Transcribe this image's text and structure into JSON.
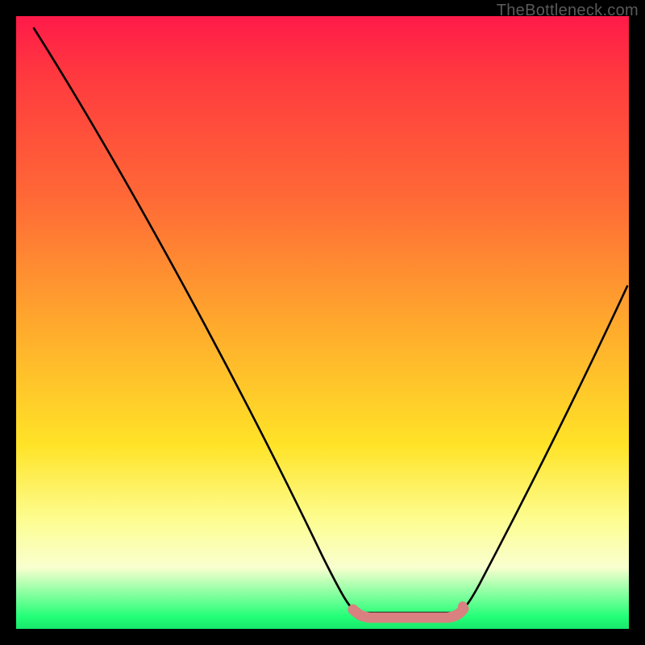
{
  "watermark": {
    "text": "TheBottleneck.com"
  },
  "chart_data": {
    "type": "line",
    "title": "",
    "xlabel": "",
    "ylabel": "",
    "xlim": [
      0,
      100
    ],
    "ylim": [
      0,
      100
    ],
    "grid": false,
    "legend": "none",
    "annotations": [],
    "series": [
      {
        "name": "curve-left",
        "x": [
          3,
          10,
          20,
          30,
          40,
          48,
          52,
          54,
          55.5
        ],
        "values": [
          98,
          88,
          73,
          57,
          40,
          23,
          12,
          6,
          3
        ]
      },
      {
        "name": "curve-right",
        "x": [
          72,
          74,
          77,
          82,
          88,
          94,
          100
        ],
        "values": [
          3,
          6,
          12,
          22,
          34,
          46,
          56
        ]
      },
      {
        "name": "flat-min-marker",
        "x": [
          55,
          57,
          59,
          61,
          63,
          65,
          67,
          69,
          70.5,
          72
        ],
        "values": [
          2.8,
          2.4,
          2.2,
          2.2,
          2.2,
          2.2,
          2.3,
          2.5,
          2.8,
          3.0
        ]
      }
    ],
    "background_gradient": {
      "stops": [
        {
          "pct": 0,
          "color": "#ff1a49"
        },
        {
          "pct": 10,
          "color": "#ff3a3f"
        },
        {
          "pct": 30,
          "color": "#ff6a36"
        },
        {
          "pct": 50,
          "color": "#ffa82d"
        },
        {
          "pct": 70,
          "color": "#ffe327"
        },
        {
          "pct": 82,
          "color": "#fdfd8f"
        },
        {
          "pct": 90,
          "color": "#f9ffcf"
        },
        {
          "pct": 98,
          "color": "#23ff77"
        },
        {
          "pct": 100,
          "color": "#19e86b"
        }
      ]
    },
    "curve_color": "#000000",
    "marker_color": "#d98080"
  }
}
